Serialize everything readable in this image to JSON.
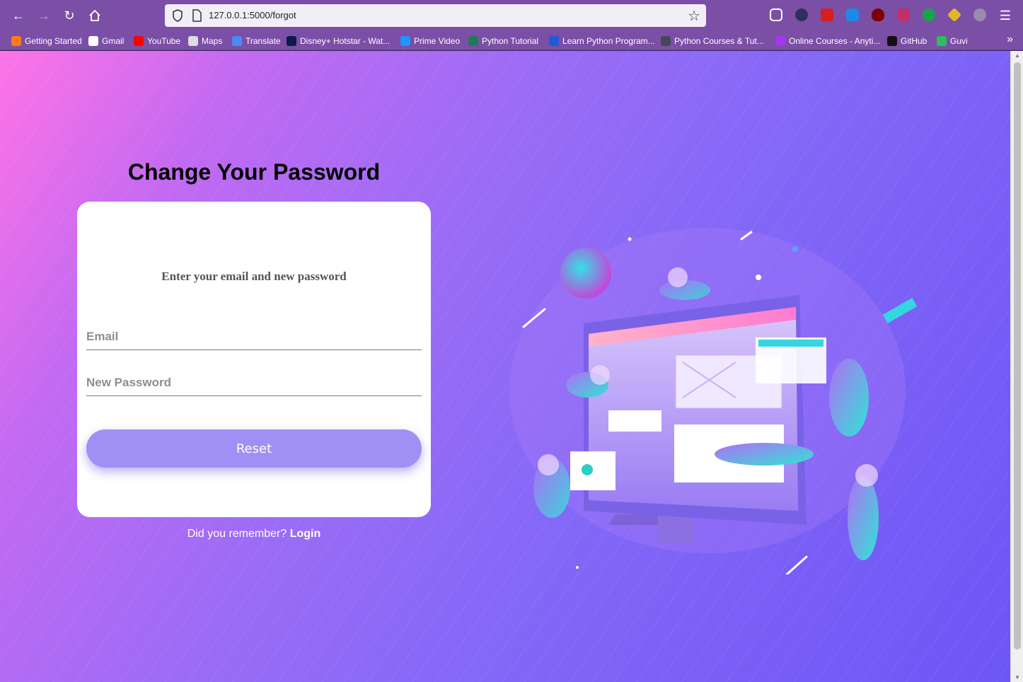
{
  "browser": {
    "url": "127.0.0.1:5000/forgot",
    "bookmarks": [
      {
        "label": "Getting Started",
        "color": "#ff7a18"
      },
      {
        "label": "Gmail",
        "color": "#ffffff"
      },
      {
        "label": "YouTube",
        "color": "#ff0000"
      },
      {
        "label": "Maps",
        "color": "#dddddd"
      },
      {
        "label": "Translate",
        "color": "#4a8af4"
      },
      {
        "label": "Disney+ Hotstar - Wat...",
        "color": "#0c1a4b"
      },
      {
        "label": "Prime Video",
        "color": "#1a98ff"
      },
      {
        "label": "Python Tutorial",
        "color": "#1f7a5a"
      },
      {
        "label": "Learn Python Program...",
        "color": "#1f5bd8"
      },
      {
        "label": "Python Courses & Tut...",
        "color": "#44475a"
      },
      {
        "label": "Online Courses - Anyti...",
        "color": "#a435f0"
      },
      {
        "label": "GitHub",
        "color": "#111111"
      },
      {
        "label": "Guvi",
        "color": "#2dbe60"
      }
    ]
  },
  "page": {
    "title": "Change Your Password",
    "subtitle": "Enter your email and new password",
    "email_placeholder": "Email",
    "password_placeholder": "New Password",
    "reset_label": "Reset",
    "footer_prompt": "Did you remember?",
    "login_label": "Login"
  }
}
